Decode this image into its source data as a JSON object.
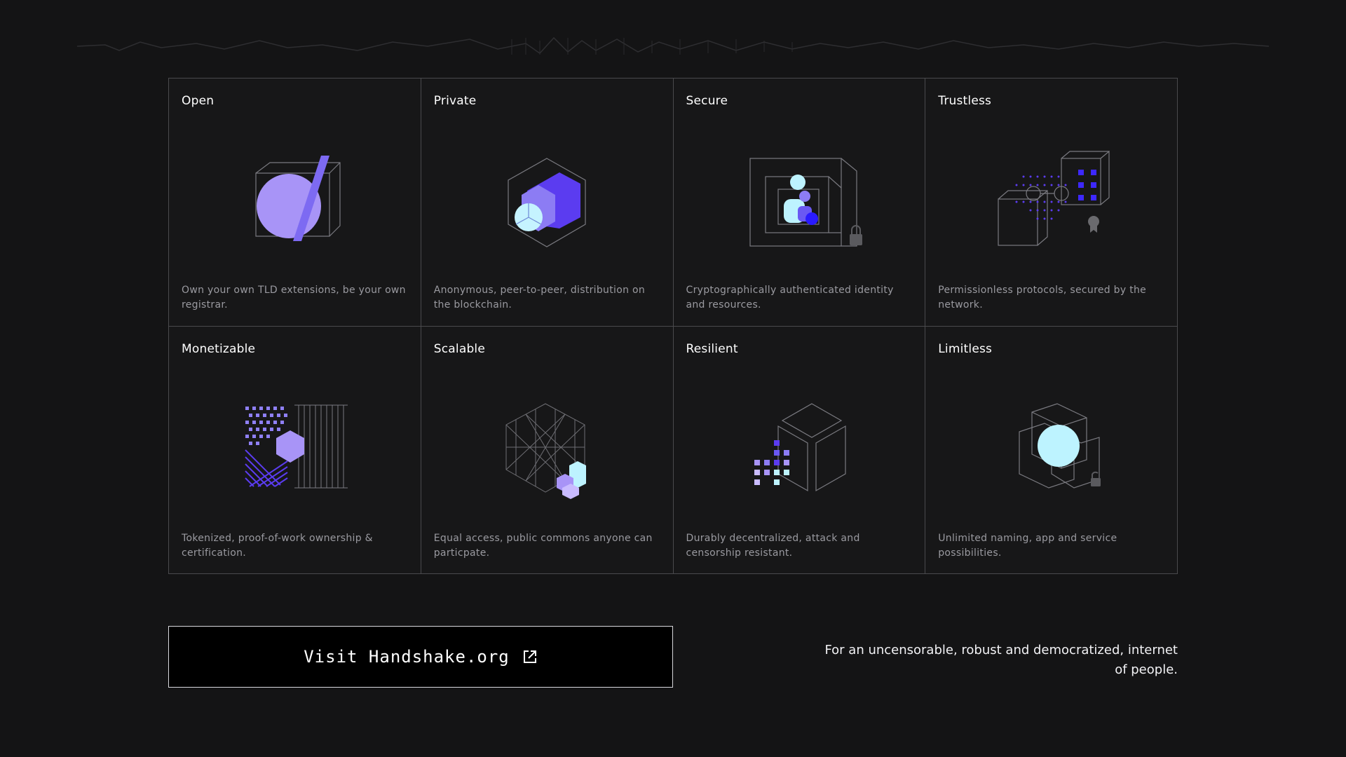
{
  "features": [
    {
      "title": "Open",
      "desc": "Own your own TLD extensions, be your own registrar."
    },
    {
      "title": "Private",
      "desc": "Anonymous, peer-to-peer, distribution on the blockchain."
    },
    {
      "title": "Secure",
      "desc": "Cryptographically authenticated identity and resources."
    },
    {
      "title": "Trustless",
      "desc": "Permissionless protocols, secured by the network."
    },
    {
      "title": "Monetizable",
      "desc": "Tokenized, proof-of-work ownership & certification."
    },
    {
      "title": "Scalable",
      "desc": "Equal access, public commons anyone can particpate."
    },
    {
      "title": "Resilient",
      "desc": "Durably decentralized, attack and censorship resistant."
    },
    {
      "title": "Limitless",
      "desc": "Unlimited naming, app and service possibilities."
    }
  ],
  "cta": {
    "label": "Visit Handshake.org",
    "icon": "external-link-icon"
  },
  "tagline": "For an uncensorable, robust and democratized, internet of people.",
  "colors": {
    "background": "#141415",
    "violet": "#a08cf5",
    "indigo": "#5b3cf0",
    "blue": "#2a1aff",
    "cyan": "#b8f4ff",
    "line": "#8a8a8f"
  }
}
